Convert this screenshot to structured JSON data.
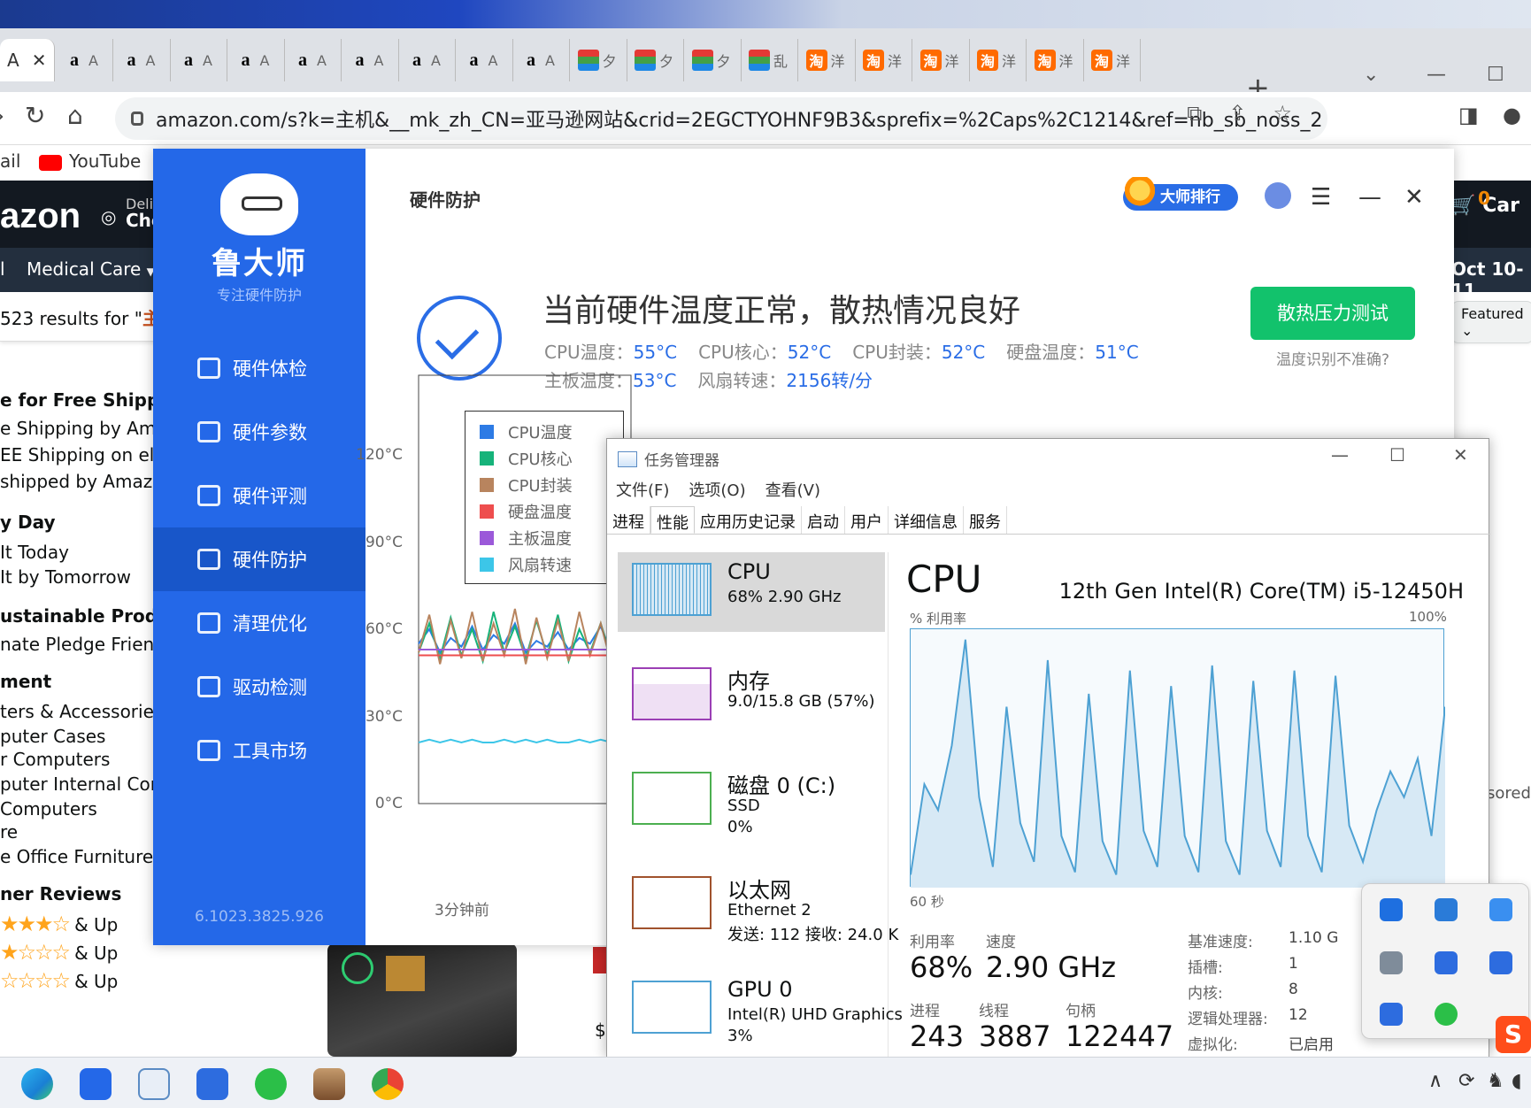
{
  "browser": {
    "tabs": [
      {
        "fav": "a",
        "sub": "A",
        "kind": "amz"
      },
      {
        "fav": "a",
        "sub": "A",
        "kind": "amz"
      },
      {
        "fav": "a",
        "sub": "A",
        "kind": "amz"
      },
      {
        "fav": "a",
        "sub": "A",
        "kind": "amz"
      },
      {
        "fav": "a",
        "sub": "A",
        "kind": "amz"
      },
      {
        "fav": "a",
        "sub": "A",
        "kind": "amz"
      },
      {
        "fav": "a",
        "sub": "A",
        "kind": "amz"
      },
      {
        "fav": "a",
        "sub": "A",
        "kind": "amz"
      },
      {
        "fav": "a",
        "sub": "A",
        "kind": "amz"
      },
      {
        "fav": "",
        "sub": "夕",
        "kind": "bag"
      },
      {
        "fav": "",
        "sub": "夕",
        "kind": "bag"
      },
      {
        "fav": "",
        "sub": "夕",
        "kind": "bag"
      },
      {
        "fav": "",
        "sub": "乱",
        "kind": "bag"
      },
      {
        "fav": "淘",
        "sub": "洋",
        "kind": "tao"
      },
      {
        "fav": "淘",
        "sub": "洋",
        "kind": "tao"
      },
      {
        "fav": "淘",
        "sub": "洋",
        "kind": "tao"
      },
      {
        "fav": "淘",
        "sub": "洋",
        "kind": "tao"
      },
      {
        "fav": "淘",
        "sub": "洋",
        "kind": "tao"
      },
      {
        "fav": "淘",
        "sub": "洋",
        "kind": "tao"
      }
    ],
    "active_tab_letter": "A",
    "active_tab_close": "✕",
    "new_tab": "+",
    "url": "amazon.com/s?k=主机&__mk_zh_CN=亚马逊网站&crid=2EGCTYOHNF9B3&sprefix=%2Caps%2C1214&ref=nb_sb_noss_2",
    "bookmarks": {
      "mail": "ail",
      "youtube": "YouTube"
    }
  },
  "amazon": {
    "logo": "azon",
    "deliver_label": "Deli",
    "deliver_loc": "Cho",
    "cart_count": "0",
    "cart_label": "Car",
    "nav_item": "Medical Care",
    "nav_left": "l",
    "delivery_date": "Oct 10-11",
    "results_prefix": "523 results for \"",
    "results_term": "主",
    "sort_label": "Featured",
    "right_text": "sored",
    "sidebar": [
      {
        "text": "e for Free Shipping",
        "bold": true
      },
      {
        "text": "e Shipping by Amaz",
        "bold": false
      },
      {
        "text": "EE Shipping on elig",
        "bold": false
      },
      {
        "text": "shipped by Amazon",
        "bold": false
      },
      {
        "text": "y Day",
        "bold": true
      },
      {
        "text": "It Today",
        "bold": false
      },
      {
        "text": "It by Tomorrow",
        "bold": false
      },
      {
        "text": "ustainable Produc",
        "bold": true
      },
      {
        "text": "nate Pledge Friend",
        "bold": false
      },
      {
        "text": "ment",
        "bold": true
      },
      {
        "text": "ters & Accessories",
        "bold": false
      },
      {
        "text": "puter Cases",
        "bold": false
      },
      {
        "text": "r Computers",
        "bold": false
      },
      {
        "text": "puter Internal Com",
        "bold": false
      },
      {
        "text": "Computers",
        "bold": false
      },
      {
        "text": "re",
        "bold": false
      },
      {
        "text": "e Office Furniture",
        "bold": false
      },
      {
        "text": "ner Reviews",
        "bold": true
      }
    ],
    "reviews": [
      {
        "stars": "★★★☆",
        "label": "& Up"
      },
      {
        "stars": "★☆☆☆",
        "label": "& Up"
      },
      {
        "stars": "☆☆☆☆",
        "label": "& Up"
      }
    ],
    "price_prefix": "$"
  },
  "ludashi": {
    "brand": "鲁大师",
    "slogan": "专注硬件防护",
    "menu": [
      "硬件体检",
      "硬件参数",
      "硬件评测",
      "硬件防护",
      "清理优化",
      "驱动检测",
      "工具市场"
    ],
    "active_menu": 3,
    "version": "6.1023.3825.926",
    "page_title": "硬件防护",
    "rank_button": "大师排行",
    "status": "当前硬件温度正常，散热情况良好",
    "metrics_row1": [
      {
        "label": "CPU温度：",
        "value": "55°C"
      },
      {
        "label": "CPU核心：",
        "value": "52°C"
      },
      {
        "label": "CPU封装：",
        "value": "52°C"
      },
      {
        "label": "硬盘温度：",
        "value": "51°C"
      }
    ],
    "metrics_row2": [
      {
        "label": "主板温度：",
        "value": "53°C"
      },
      {
        "label": "风扇转速：",
        "value": "2156转/分"
      }
    ],
    "stress_button": "散热压力测试",
    "inaccurate_link": "温度识别不准确?",
    "colors": {
      "sidebar": "#2468e8",
      "accent": "#2a6de6",
      "green": "#12c26c"
    }
  },
  "chart_data": {
    "type": "line",
    "y_ticks": [
      "120°C",
      "90°C",
      "60°C",
      "30°C",
      "0°C"
    ],
    "ylim": [
      0,
      120
    ],
    "x_label": "3分钟前",
    "series": [
      {
        "name": "CPU温度",
        "color": "#2d7be5",
        "values": [
          55,
          60,
          52,
          57,
          54,
          61,
          53,
          58,
          55,
          62,
          52,
          56,
          54,
          59,
          53,
          57,
          55,
          61,
          52,
          55
        ]
      },
      {
        "name": "CPU核心",
        "color": "#16b37a",
        "values": [
          52,
          62,
          50,
          64,
          51,
          60,
          49,
          66,
          52,
          61,
          50,
          63,
          51,
          65,
          49,
          60,
          52,
          62,
          50,
          58
        ]
      },
      {
        "name": "CPU封装",
        "color": "#b8845e",
        "values": [
          52,
          65,
          48,
          63,
          50,
          66,
          49,
          62,
          51,
          67,
          48,
          64,
          50,
          63,
          49,
          66,
          51,
          62,
          48,
          60
        ]
      },
      {
        "name": "硬盘温度",
        "color": "#ee4e4e",
        "values": [
          51,
          51,
          51,
          51,
          51,
          51,
          51,
          51,
          51,
          51,
          51,
          51,
          51,
          51,
          51,
          51,
          51,
          51,
          51,
          51
        ]
      },
      {
        "name": "主板温度",
        "color": "#9b59d9",
        "values": [
          53,
          53,
          53,
          53,
          53,
          53,
          53,
          53,
          53,
          53,
          53,
          53,
          53,
          53,
          53,
          53,
          53,
          53,
          53,
          53
        ]
      },
      {
        "name": "风扇转速",
        "color": "#3cc6e8",
        "values": [
          21,
          22,
          21,
          22,
          21,
          22,
          21,
          21,
          22,
          21,
          22,
          21,
          22,
          21,
          21,
          22,
          21,
          22,
          21,
          22
        ]
      }
    ]
  },
  "taskmgr": {
    "title": "任务管理器",
    "menu": [
      "文件(F)",
      "选项(O)",
      "查看(V)"
    ],
    "tabs": [
      "进程",
      "性能",
      "应用历史记录",
      "启动",
      "用户",
      "详细信息",
      "服务"
    ],
    "active_tab": 1,
    "list": [
      {
        "name": "CPU",
        "sub1": "68%  2.90 GHz",
        "sub2": "",
        "sub3": ""
      },
      {
        "name": "内存",
        "sub1": "9.0/15.8 GB (57%)",
        "sub2": "",
        "sub3": ""
      },
      {
        "name": "磁盘 0 (C:)",
        "sub1": "SSD",
        "sub2": "0%",
        "sub3": ""
      },
      {
        "name": "以太网",
        "sub1": "Ethernet 2",
        "sub2": "发送: 112  接收: 24.0 K",
        "sub3": ""
      },
      {
        "name": "GPU 0",
        "sub1": "Intel(R) UHD Graphics",
        "sub2": "3%",
        "sub3": ""
      }
    ],
    "main_title": "CPU",
    "model": "12th Gen Intel(R) Core(TM) i5-12450H",
    "axis_util": "% 利用率",
    "axis_max": "100%",
    "axis_time": "60 秒",
    "cpu_graph": [
      5,
      40,
      30,
      55,
      96,
      35,
      8,
      70,
      25,
      10,
      88,
      20,
      6,
      75,
      18,
      5,
      84,
      22,
      8,
      78,
      20,
      6,
      86,
      18,
      5,
      80,
      22,
      8,
      84,
      20,
      6,
      82,
      24,
      10,
      30,
      45,
      35,
      50,
      20,
      70
    ],
    "stats": {
      "util_label": "利用率",
      "util": "68%",
      "speed_label": "速度",
      "speed": "2.90 GHz",
      "proc_label": "进程",
      "proc": "243",
      "thread_label": "线程",
      "thread": "3887",
      "handle_label": "句柄",
      "handle": "122447"
    },
    "specs": [
      {
        "k": "基准速度:",
        "v": "1.10 G"
      },
      {
        "k": "插槽:",
        "v": "1"
      },
      {
        "k": "内核:",
        "v": "8"
      },
      {
        "k": "逻辑处理器:",
        "v": "12"
      },
      {
        "k": "虚拟化:",
        "v": "已启用"
      }
    ],
    "colors": {
      "line": "#4ea1d3",
      "fill": "#d7e9f5"
    }
  },
  "tray": {
    "sogou": "S"
  },
  "taskbar": {
    "chevron": "∧"
  }
}
